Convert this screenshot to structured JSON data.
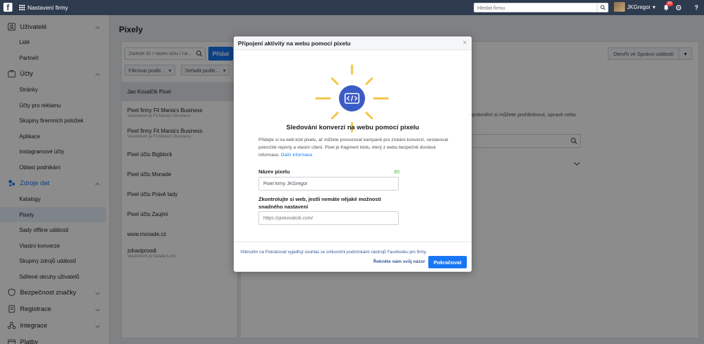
{
  "topbar": {
    "logo": "f",
    "business_label": "Nastavení firmy",
    "search_placeholder": "Hledat firmu",
    "user_name": "JKGregor",
    "notification_count": "20"
  },
  "sidebar": {
    "sections": [
      {
        "label": "Uživatelé",
        "icon": "users-icon",
        "items": [
          "Lidé",
          "Partneři"
        ]
      },
      {
        "label": "Účty",
        "icon": "accounts-icon",
        "items": [
          "Stránky",
          "Účty pro reklamu",
          "Skupiny firemních položek",
          "Aplikace",
          "Instagramové účty",
          "Oblast podnikání"
        ]
      },
      {
        "label": "Zdroje dat",
        "icon": "data-sources-icon",
        "items": [
          "Katalogy",
          "Pixely",
          "Sady offline událostí",
          "Vlastní konverze",
          "Skupiny zdrojů událostí",
          "Sdílené okruhy uživatelů"
        ]
      },
      {
        "label": "Bezpečnost značky",
        "icon": "shield-icon",
        "items": []
      },
      {
        "label": "Registrace",
        "icon": "registration-icon",
        "items": []
      },
      {
        "label": "Integrace",
        "icon": "integrations-icon",
        "items": []
      },
      {
        "label": "Platby",
        "icon": "payments-icon",
        "items": []
      }
    ],
    "active_item": "Pixely"
  },
  "main": {
    "title": "Pixely",
    "search_placeholder": "Zadejte ID / název účtu / ná...",
    "add_label": "Přidat",
    "filter_label": "Filtrovat podle...",
    "sort_label": "Seřadit podle...",
    "pixels": [
      {
        "name": "Jan Kovalčík Pixel",
        "owner": ""
      },
      {
        "name": "Pixel firmy Fit Mania's Business",
        "owner": "Vlastníkem je Fit Mania's Business"
      },
      {
        "name": "Pixel firmy Fit Mania's Business",
        "owner": "Vlastníkem je Fit Mania's Business"
      },
      {
        "name": "Pixel účtu Bigblock",
        "owner": ""
      },
      {
        "name": "Pixel účtu Monade",
        "owner": ""
      },
      {
        "name": "Pixel účtu Právě tady",
        "owner": ""
      },
      {
        "name": "Pixel účtu Zaujmi",
        "owner": ""
      },
      {
        "name": "www.monade.cz",
        "owner": ""
      },
      {
        "name": "zdraviproodi",
        "owner": "Vlastníkem je Natalie Lenc"
      }
    ],
    "open_events_manager": "Otevřít ve Správci událostí",
    "background_text": "oprávnění si můžete prohlédnout, upravit nebo"
  },
  "modal": {
    "header": "Připojení aktivity na webu pomocí pixelu",
    "title": "Sledování konverzí na webu pomocí pixelu",
    "description": "Přidejte si na web kód pixelu, ať můžete provozovat kampaně pro získání konverzí, sestavovat pokročilé reporty a vlastní cílení. Pixel je fragment kódu, který z webu bezpečně dostává informace.",
    "learn_more": "Další informace",
    "pixel_name_label": "Název pixelu",
    "pixel_name_counter": "30",
    "pixel_name_value": "Pixel firmy JKGregor",
    "website_label_line1": "Zkontrolujte si web, jestli nemáte nějaké možnosti",
    "website_label_line2": "snadného nastavení",
    "website_placeholder": "https://jankovalcik.com/",
    "terms": "Kliknutím na Pokračovat vyjadřují souhlas se smluvními podmínkami nástrojů Facebooku pro firmy.",
    "feedback": "Řekněte nám svůj názor",
    "continue": "Pokračovat"
  },
  "colors": {
    "topbar": "#2e3b4e",
    "primary": "#1877f2",
    "hero_circle": "#3b5cc6",
    "sun_rays": "#f5c344"
  }
}
